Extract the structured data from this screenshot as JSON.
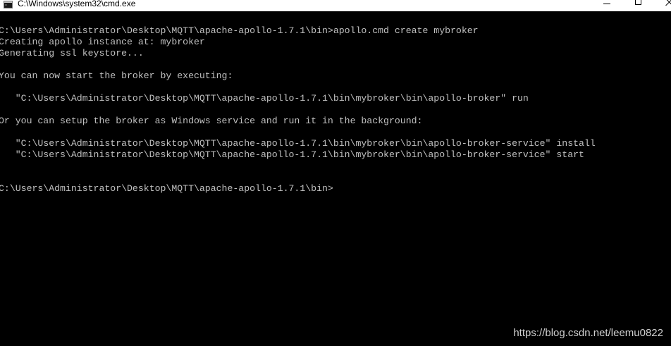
{
  "window": {
    "title": "C:\\Windows\\system32\\cmd.exe",
    "icon": "cmd-icon"
  },
  "controls": {
    "minimize": "minimize-icon",
    "maximize": "maximize-icon",
    "close": "close-icon"
  },
  "console": {
    "lines": [
      "C:\\Users\\Administrator\\Desktop\\MQTT\\apache-apollo-1.7.1\\bin>apollo.cmd create mybroker",
      "Creating apollo instance at: mybroker",
      "Generating ssl keystore...",
      "",
      "You can now start the broker by executing:",
      "",
      "   \"C:\\Users\\Administrator\\Desktop\\MQTT\\apache-apollo-1.7.1\\bin\\mybroker\\bin\\apollo-broker\" run",
      "",
      "Or you can setup the broker as Windows service and run it in the background:",
      "",
      "   \"C:\\Users\\Administrator\\Desktop\\MQTT\\apache-apollo-1.7.1\\bin\\mybroker\\bin\\apollo-broker-service\" install",
      "   \"C:\\Users\\Administrator\\Desktop\\MQTT\\apache-apollo-1.7.1\\bin\\mybroker\\bin\\apollo-broker-service\" start",
      "",
      "",
      "C:\\Users\\Administrator\\Desktop\\MQTT\\apache-apollo-1.7.1\\bin>"
    ]
  },
  "watermark": "https://blog.csdn.net/leemu0822",
  "colors": {
    "console_background": "#000000",
    "console_text": "#c0c0c0",
    "titlebar_background": "#ffffff"
  }
}
